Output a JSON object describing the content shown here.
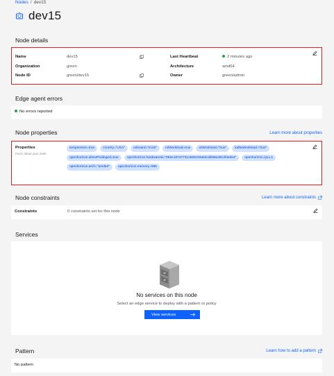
{
  "breadcrumb": {
    "parent": "Nodes",
    "separator": "/",
    "current": "dev15"
  },
  "title": "dev15",
  "node_details": {
    "title": "Node details",
    "name_label": "Name",
    "name_value": "dev15",
    "org_label": "Organization",
    "org_value": "green",
    "id_label": "Node ID",
    "id_value": "green/dev15",
    "heartbeat_label": "Last Heartbeat",
    "heartbeat_value": "2 minutes ago",
    "arch_label": "Architecture",
    "arch_value": "amd64",
    "owner_label": "Owner",
    "owner_value": "green/admin"
  },
  "edge_errors": {
    "title": "Edge agent errors",
    "message": "No errors reported"
  },
  "node_properties": {
    "title": "Node properties",
    "learn_link": "Learn more about properties",
    "label": "Properties",
    "subtitle": "Facts about your node",
    "chips": [
      "tempsensor=true",
      "country=\"USA\"",
      "onboard=\"truck\"",
      "mlWorkload=true",
      "iotWorkload=\"true\"",
      "kafkaWorkload=\"true\"",
      "openhorizon.allowPrivileged=true",
      "openhorizon.hardwareId=\"992e18737731e565c93a53cdb98a4813f4ede4\"",
      "openhorizon.cpu=1",
      "openhorizon.arch=\"amd64\"",
      "openhorizon.memory=985"
    ]
  },
  "node_constraints": {
    "title": "Node constraints",
    "learn_link": "Learn more about constraints",
    "label": "Constraints",
    "value": "0 constraints set for this node"
  },
  "services": {
    "title": "Services",
    "empty_title": "No services on this node",
    "empty_sub": "Select an edge service to deploy with a pattern or policy",
    "button": "View services"
  },
  "pattern": {
    "title": "Pattern",
    "learn_link": "Learn how to add a pattern",
    "value": "No pattern"
  },
  "colors": {
    "accent": "#0f62fe",
    "highlight_border": "#e81c1c",
    "status_ok": "#24a148",
    "chip_bg": "#d0e2ff"
  },
  "icons": [
    "node-icon",
    "copy-icon",
    "edit-icon",
    "external-link-icon",
    "server-cabinet-illustration",
    "arrow-right-icon"
  ]
}
